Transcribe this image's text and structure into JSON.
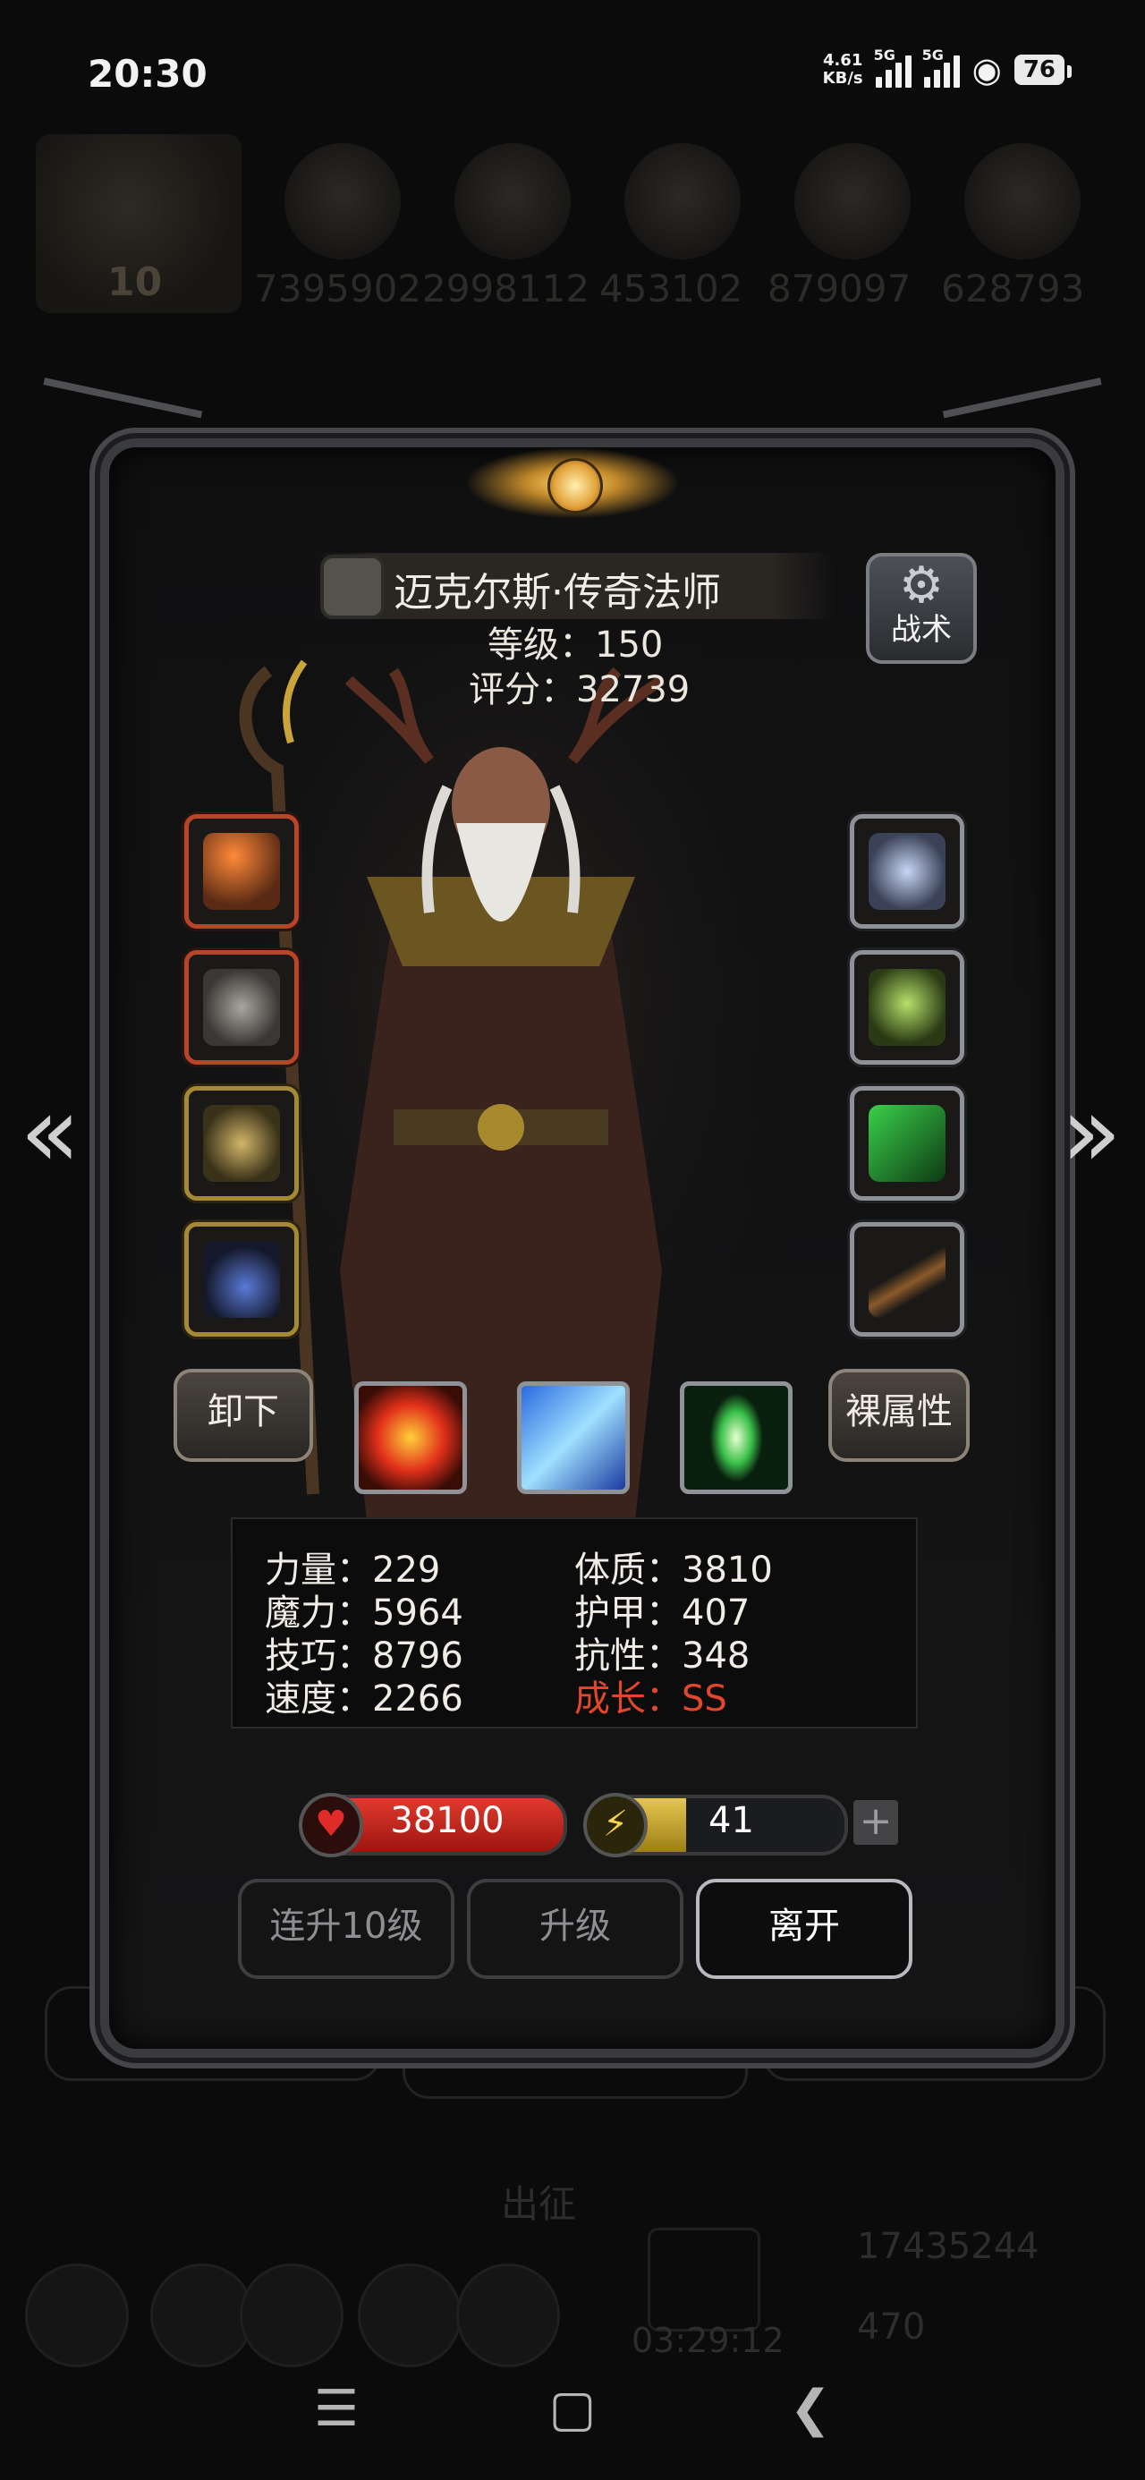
{
  "status_bar": {
    "time": "20:30",
    "net_speed_value": "4.61",
    "net_speed_unit": "KB/s",
    "signal1_tag": "5G",
    "signal2_tag": "5G",
    "battery": "76"
  },
  "resources_bg": {
    "avatar_level": "10",
    "values": [
      "7395902",
      "2998112",
      "453102",
      "879097",
      "628793"
    ]
  },
  "hero": {
    "name": "迈克尔斯·传奇法师",
    "level_line": "等级：150",
    "score_line": "评分：32739"
  },
  "tactics_label": "战术",
  "buttons": {
    "unequip": "卸下",
    "base_attributes": "裸属性"
  },
  "stats": {
    "strength": "力量：229",
    "magic": "魔力：5964",
    "skill": "技巧：8796",
    "speed": "速度：2266",
    "constitution": "体质：3810",
    "armor": "护甲：407",
    "resistance": "抗性：348",
    "growth": "成长：SS"
  },
  "bars": {
    "hp": "38100",
    "energy": "41",
    "energy_fill_fraction": 0.38,
    "plus": "+"
  },
  "actions": {
    "level_up_10": "连升10级",
    "level_up": "升级",
    "leave": "离开"
  },
  "underlay": {
    "expedition": "出征",
    "timer": "03:29:12",
    "gold": "17435244",
    "gems": "470"
  },
  "colors": {
    "growth_red": "#e2472b",
    "hp_red": "#e13a2e",
    "energy_gold": "#e6c650"
  }
}
